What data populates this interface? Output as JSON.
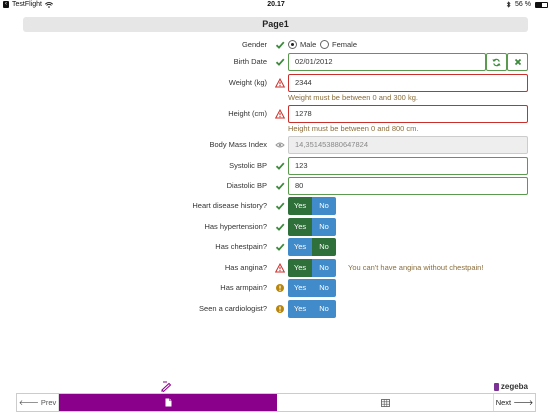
{
  "statusbar": {
    "app_back": "TestFlight",
    "time": "20.17",
    "battery_percent_label": "56 %",
    "battery_level": 0.56
  },
  "page": {
    "title": "Page1"
  },
  "gender": {
    "label": "Gender",
    "options": [
      "Male",
      "Female"
    ],
    "selected": "Male"
  },
  "birth_date": {
    "label": "Birth Date",
    "value": "02/01/2012"
  },
  "weight": {
    "label": "Weight (kg)",
    "value": "2344",
    "error": "Weight must be between 0 and 300 kg."
  },
  "height": {
    "label": "Height (cm)",
    "value": "1278",
    "error": "Height must be between 0 and 800 cm."
  },
  "bmi": {
    "label": "Body Mass Index",
    "value": "14,351453880647824"
  },
  "systolic": {
    "label": "Systolic BP",
    "value": "123"
  },
  "diastolic": {
    "label": "Diastolic BP",
    "value": "80"
  },
  "yes_label": "Yes",
  "no_label": "No",
  "questions": [
    {
      "label": "Heart disease history?",
      "answer": "Yes",
      "status": "ok"
    },
    {
      "label": "Has hypertension?",
      "answer": "Yes",
      "status": "ok"
    },
    {
      "label": "Has chestpain?",
      "answer": "No",
      "status": "ok"
    },
    {
      "label": "Has angina?",
      "answer": "Yes",
      "status": "warning",
      "message": "You can't have angina without chestpain!"
    },
    {
      "label": "Has armpain?",
      "answer": null,
      "status": "required"
    },
    {
      "label": "Seen a cardiologist?",
      "answer": null,
      "status": "required"
    }
  ],
  "footer": {
    "brand": "zegeba",
    "prev_label": "Prev",
    "next_label": "Next"
  },
  "colors": {
    "accent": "#8b008b",
    "ok": "#3c8a3c",
    "error": "#c9302c",
    "toggle": "#428bca",
    "toggle_selected": "#2f6f3a"
  }
}
